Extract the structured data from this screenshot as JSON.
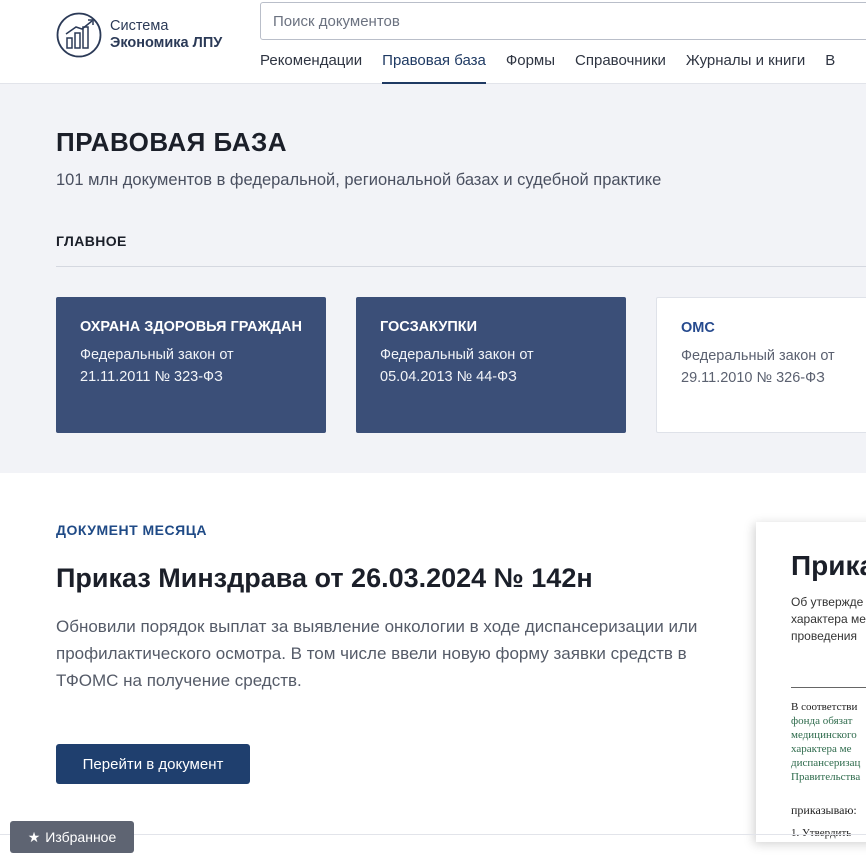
{
  "header": {
    "logo": {
      "line1": "Система",
      "line2": "Экономика ЛПУ"
    },
    "search": {
      "placeholder": "Поиск документов"
    },
    "nav": [
      {
        "label": "Рекомендации",
        "active": false
      },
      {
        "label": "Правовая база",
        "active": true
      },
      {
        "label": "Формы",
        "active": false
      },
      {
        "label": "Справочники",
        "active": false
      },
      {
        "label": "Журналы и книги",
        "active": false
      },
      {
        "label": "В",
        "active": false
      }
    ]
  },
  "hero": {
    "title": "ПРАВОВАЯ БАЗА",
    "subtitle": "101 млн документов в федеральной, региональной базах и судебной практике",
    "section_label": "ГЛАВНОЕ",
    "cards": [
      {
        "title": "ОХРАНА ЗДОРОВЬЯ ГРАЖДАН",
        "text_line1": "Федеральный закон от",
        "text_line2": "21.11.2011 № 323-ФЗ"
      },
      {
        "title": "ГОСЗАКУПКИ",
        "text_line1": "Федеральный закон от",
        "text_line2": "05.04.2013 № 44-ФЗ"
      },
      {
        "title": "ОМС",
        "text_line1": "Федеральный закон от",
        "text_line2": "29.11.2010 № 326-ФЗ"
      }
    ]
  },
  "doc_month": {
    "label": "ДОКУМЕНТ МЕСЯЦА",
    "title": "Приказ Минздрава от 26.03.2024 № 142н",
    "description": "Обновили порядок выплат за выявление онкологии в ходе диспансеризации или профилактического осмотра. В том числе ввели новую форму заявки средств в ТФОМС на получение средств.",
    "button": "Перейти в документ"
  },
  "preview": {
    "title": "Прика",
    "sub_lines": [
      "Об утвержде",
      "характера ме",
      "проведения"
    ],
    "body_lines": [
      {
        "text": "В соответстви",
        "link": false
      },
      {
        "text": "фонда обязат",
        "link": true
      },
      {
        "text": "медицинского",
        "link": true
      },
      {
        "text": "характера ме",
        "link": true
      },
      {
        "text": "диспансеризац",
        "link": true
      },
      {
        "text": "Правительства",
        "link": true
      }
    ],
    "order": "приказываю:",
    "item": "1. Утвердить"
  },
  "favorites": {
    "label": "Избранное",
    "icon": "star-icon"
  },
  "colors": {
    "accent": "#1f3f6e",
    "card_dark": "#3b4f78",
    "hero_bg": "#f2f3f7"
  }
}
